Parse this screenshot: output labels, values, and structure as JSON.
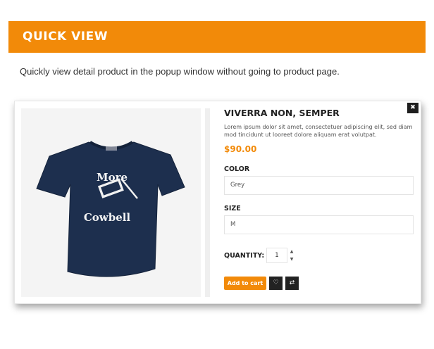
{
  "banner": {
    "title": "QUICK VIEW",
    "color": "#f28a09"
  },
  "intro_text": "Quickly view detail product in the popup window without going to product page.",
  "popup": {
    "close_icon": "close-icon",
    "product": {
      "title": "VIVERRA NON, SEMPER",
      "description": "Lorem ipsum dolor sit amet, consectetuer adipiscing elit, sed diam  mod tincidunt ut looreet dolore aliquam erat volutpat.",
      "price": "$90.00",
      "image_text": [
        "More",
        "Cowbell"
      ]
    },
    "options": {
      "color_label": "COLOR",
      "color_value": "Grey",
      "size_label": "SIZE",
      "size_value": "M"
    },
    "quantity": {
      "label": "QUANTITY:",
      "value": "1",
      "up_icon": "chevron-up-icon",
      "down_icon": "chevron-down-icon"
    },
    "actions": {
      "add_to_cart": "Add to cart",
      "wishlist_icon": "heart-icon",
      "compare_icon": "refresh-icon"
    }
  }
}
